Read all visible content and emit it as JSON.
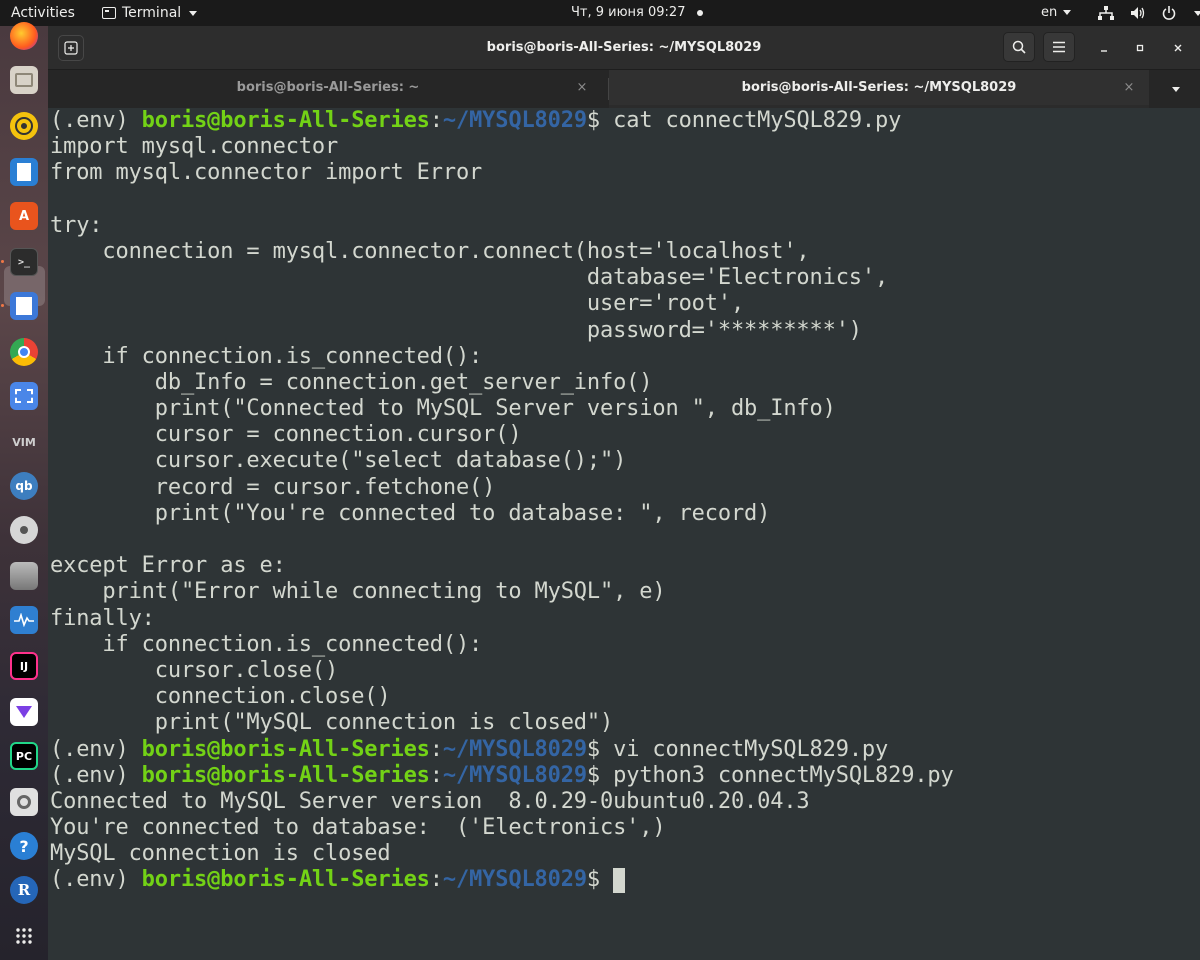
{
  "topbar": {
    "activities": "Activities",
    "app_menu": "Terminal",
    "clock": "Чт, 9 июня  09:27",
    "language": "en"
  },
  "window": {
    "title": "boris@boris-All-Series: ~/MYSQL8029",
    "tabs": [
      {
        "label": "boris@boris-All-Series: ~",
        "active": false
      },
      {
        "label": "boris@boris-All-Series: ~/MYSQL8029",
        "active": true
      }
    ],
    "close_glyph": "×"
  },
  "terminal": {
    "prompt": {
      "env": "(.env) ",
      "user_host": "boris@boris-All-Series",
      "colon": ":",
      "path": "~/MYSQL8029",
      "symbol": "$ "
    },
    "lines": [
      {
        "type": "prompt",
        "command": "cat connectMySQL829.py"
      },
      {
        "type": "text",
        "text": "import mysql.connector"
      },
      {
        "type": "text",
        "text": "from mysql.connector import Error"
      },
      {
        "type": "text",
        "text": ""
      },
      {
        "type": "text",
        "text": "try:"
      },
      {
        "type": "text",
        "text": "    connection = mysql.connector.connect(host='localhost',"
      },
      {
        "type": "text",
        "text": "                                         database='Electronics',"
      },
      {
        "type": "text",
        "text": "                                         user='root',"
      },
      {
        "type": "text",
        "text": "                                         password='*********')"
      },
      {
        "type": "text",
        "text": "    if connection.is_connected():"
      },
      {
        "type": "text",
        "text": "        db_Info = connection.get_server_info()"
      },
      {
        "type": "text",
        "text": "        print(\"Connected to MySQL Server version \", db_Info)"
      },
      {
        "type": "text",
        "text": "        cursor = connection.cursor()"
      },
      {
        "type": "text",
        "text": "        cursor.execute(\"select database();\")"
      },
      {
        "type": "text",
        "text": "        record = cursor.fetchone()"
      },
      {
        "type": "text",
        "text": "        print(\"You're connected to database: \", record)"
      },
      {
        "type": "text",
        "text": ""
      },
      {
        "type": "text",
        "text": "except Error as e:"
      },
      {
        "type": "text",
        "text": "    print(\"Error while connecting to MySQL\", e)"
      },
      {
        "type": "text",
        "text": "finally:"
      },
      {
        "type": "text",
        "text": "    if connection.is_connected():"
      },
      {
        "type": "text",
        "text": "        cursor.close()"
      },
      {
        "type": "text",
        "text": "        connection.close()"
      },
      {
        "type": "text",
        "text": "        print(\"MySQL connection is closed\")"
      },
      {
        "type": "prompt",
        "command": "vi connectMySQL829.py"
      },
      {
        "type": "prompt",
        "command": "python3 connectMySQL829.py"
      },
      {
        "type": "text",
        "text": "Connected to MySQL Server version  8.0.29-0ubuntu0.20.04.3"
      },
      {
        "type": "text",
        "text": "You're connected to database:  ('Electronics',)"
      },
      {
        "type": "text",
        "text": "MySQL connection is closed"
      },
      {
        "type": "prompt",
        "command": "",
        "cursor": true
      }
    ]
  },
  "dock": {
    "icons": [
      "firefox-icon",
      "files-icon",
      "rhythmbox-icon",
      "libreoffice-writer-icon",
      "software-center-icon",
      "terminal-icon",
      "text-editor-icon",
      "chrome-icon",
      "screenshot-icon",
      "vim-icon",
      "qbittorrent-icon",
      "disc-icon",
      "database-icon",
      "system-monitor-icon",
      "intellij-icon",
      "vpn-icon",
      "pycharm-icon",
      "settings-icon",
      "help-icon",
      "r-icon",
      "show-apps-icon"
    ]
  },
  "colors": {
    "terminal_bg": "#2e3436",
    "terminal_fg": "#d3d7cf",
    "prompt_user": "#73d216",
    "prompt_path": "#3465a4"
  }
}
